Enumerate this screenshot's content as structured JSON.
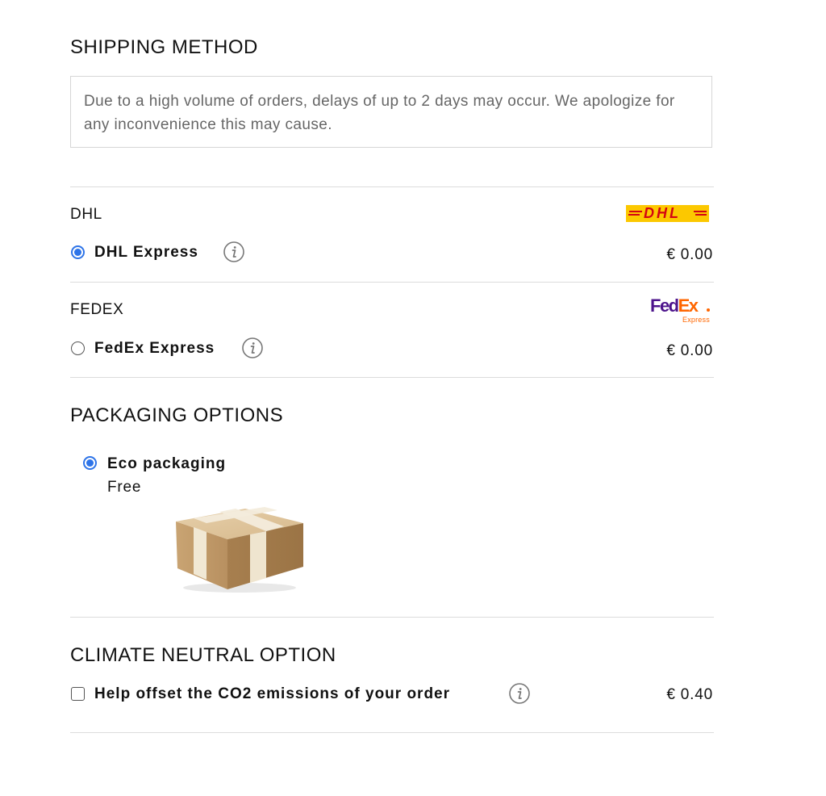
{
  "shipping": {
    "title": "SHIPPING METHOD",
    "notice": "Due to a high volume of orders, delays of up to 2 days may occur. We apologize for any inconvenience this may cause.",
    "carriers": [
      {
        "name": "DHL",
        "logo_text": "DHL",
        "option_label": "DHL Express",
        "price": "€ 0.00",
        "selected": true,
        "info_icon": "info-icon"
      },
      {
        "name": "FEDEX",
        "logo_text": "FedEx",
        "logo_sub": "Express",
        "option_label": "FedEx Express",
        "price": "€ 0.00",
        "selected": false,
        "info_icon": "info-icon"
      }
    ]
  },
  "packaging": {
    "title": "PACKAGING OPTIONS",
    "option_label": "Eco packaging",
    "option_price": "Free",
    "selected": true
  },
  "climate": {
    "title": "CLIMATE NEUTRAL OPTION",
    "option_label": "Help offset the CO2 emissions of your order",
    "price": "€ 0.40",
    "checked": false,
    "info_icon": "info-icon"
  },
  "colors": {
    "accent": "#2e74e8",
    "dhl_yellow": "#fcc800",
    "dhl_red": "#d40511",
    "fedex_purple": "#4d148c",
    "fedex_orange": "#ff6600",
    "divider": "#dcdcdc"
  }
}
